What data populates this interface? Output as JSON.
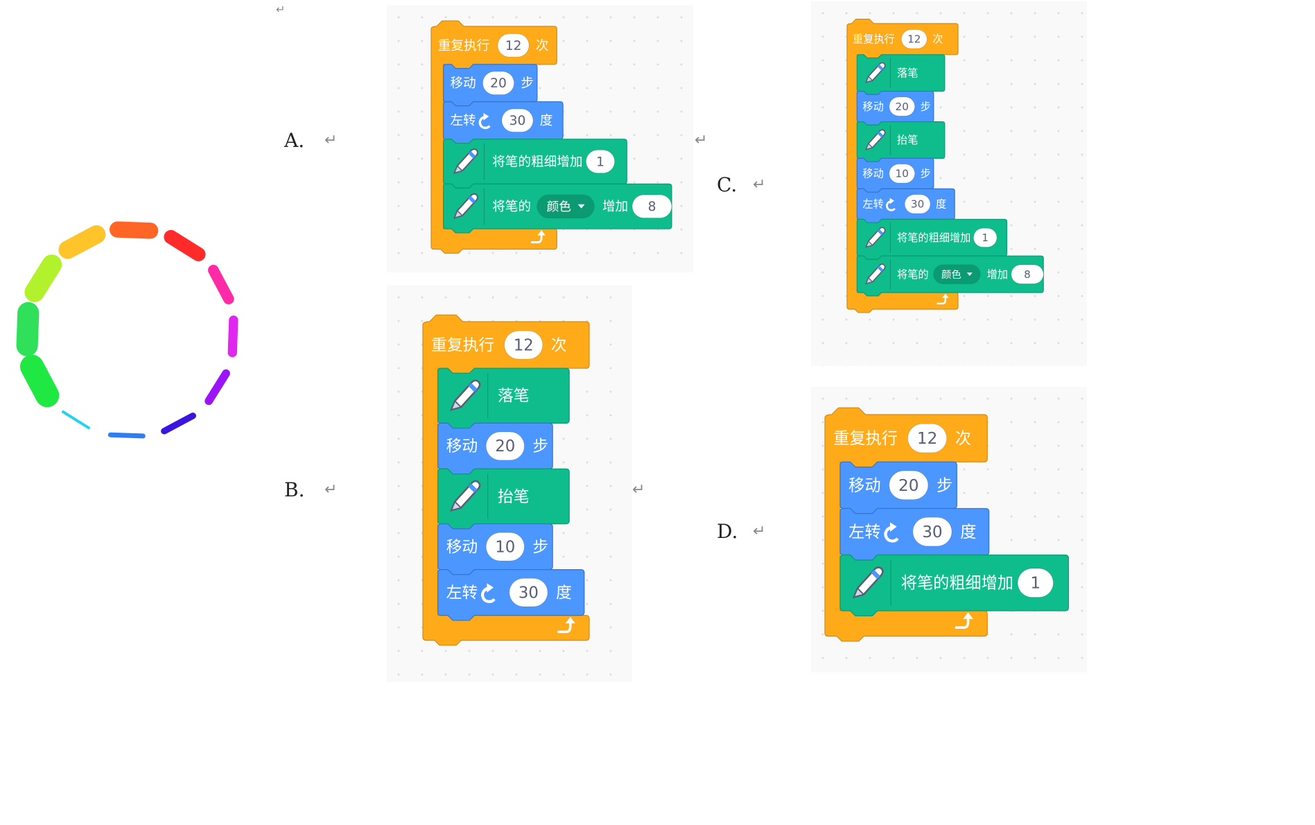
{
  "top_mark": "↵",
  "result_preview": {
    "segments": [
      {
        "color": "#ff2b2b",
        "thickness": 26
      },
      {
        "color": "#ff2aa6",
        "thickness": 20
      },
      {
        "color": "#e027f0",
        "thickness": 17
      },
      {
        "color": "#9a14f5",
        "thickness": 15
      },
      {
        "color": "#3b14e0",
        "thickness": 12
      },
      {
        "color": "#2f7df0",
        "thickness": 9
      },
      {
        "color": "#22d2ee",
        "thickness": 5
      },
      {
        "color": "#1ee841",
        "thickness": 44
      },
      {
        "color": "#30e05b",
        "thickness": 40
      },
      {
        "color": "#b2f22c",
        "thickness": 37
      },
      {
        "color": "#ffc429",
        "thickness": 34
      },
      {
        "color": "#ff6626",
        "thickness": 30
      }
    ]
  },
  "options": [
    {
      "letter": "A.",
      "mark": "↵"
    },
    {
      "letter": "B.",
      "mark": "↵"
    },
    {
      "letter": "C.",
      "mark": "↵"
    },
    {
      "letter": "D.",
      "mark": "↵"
    }
  ],
  "separators": {
    "after_a": "↵",
    "after_b": "↵"
  },
  "colors": {
    "control": "#ffab19",
    "motion": "#4c97ff",
    "pen": "#0fbd8c",
    "pen_dark": "#0b9a72"
  },
  "blocks": {
    "repeat": "重复执行",
    "times": "次",
    "count": "12",
    "move": "移动",
    "steps": "步",
    "turn_left": "左转",
    "degrees": "度",
    "pen_down": "落笔",
    "pen_up": "抬笔",
    "change_size": "将笔的粗细增加",
    "change_param": "将笔的",
    "param_color": "颜色",
    "change_by": "增加",
    "move_20": "20",
    "move_10": "10",
    "angle": "30",
    "size_step": "1",
    "color_step": "8"
  }
}
